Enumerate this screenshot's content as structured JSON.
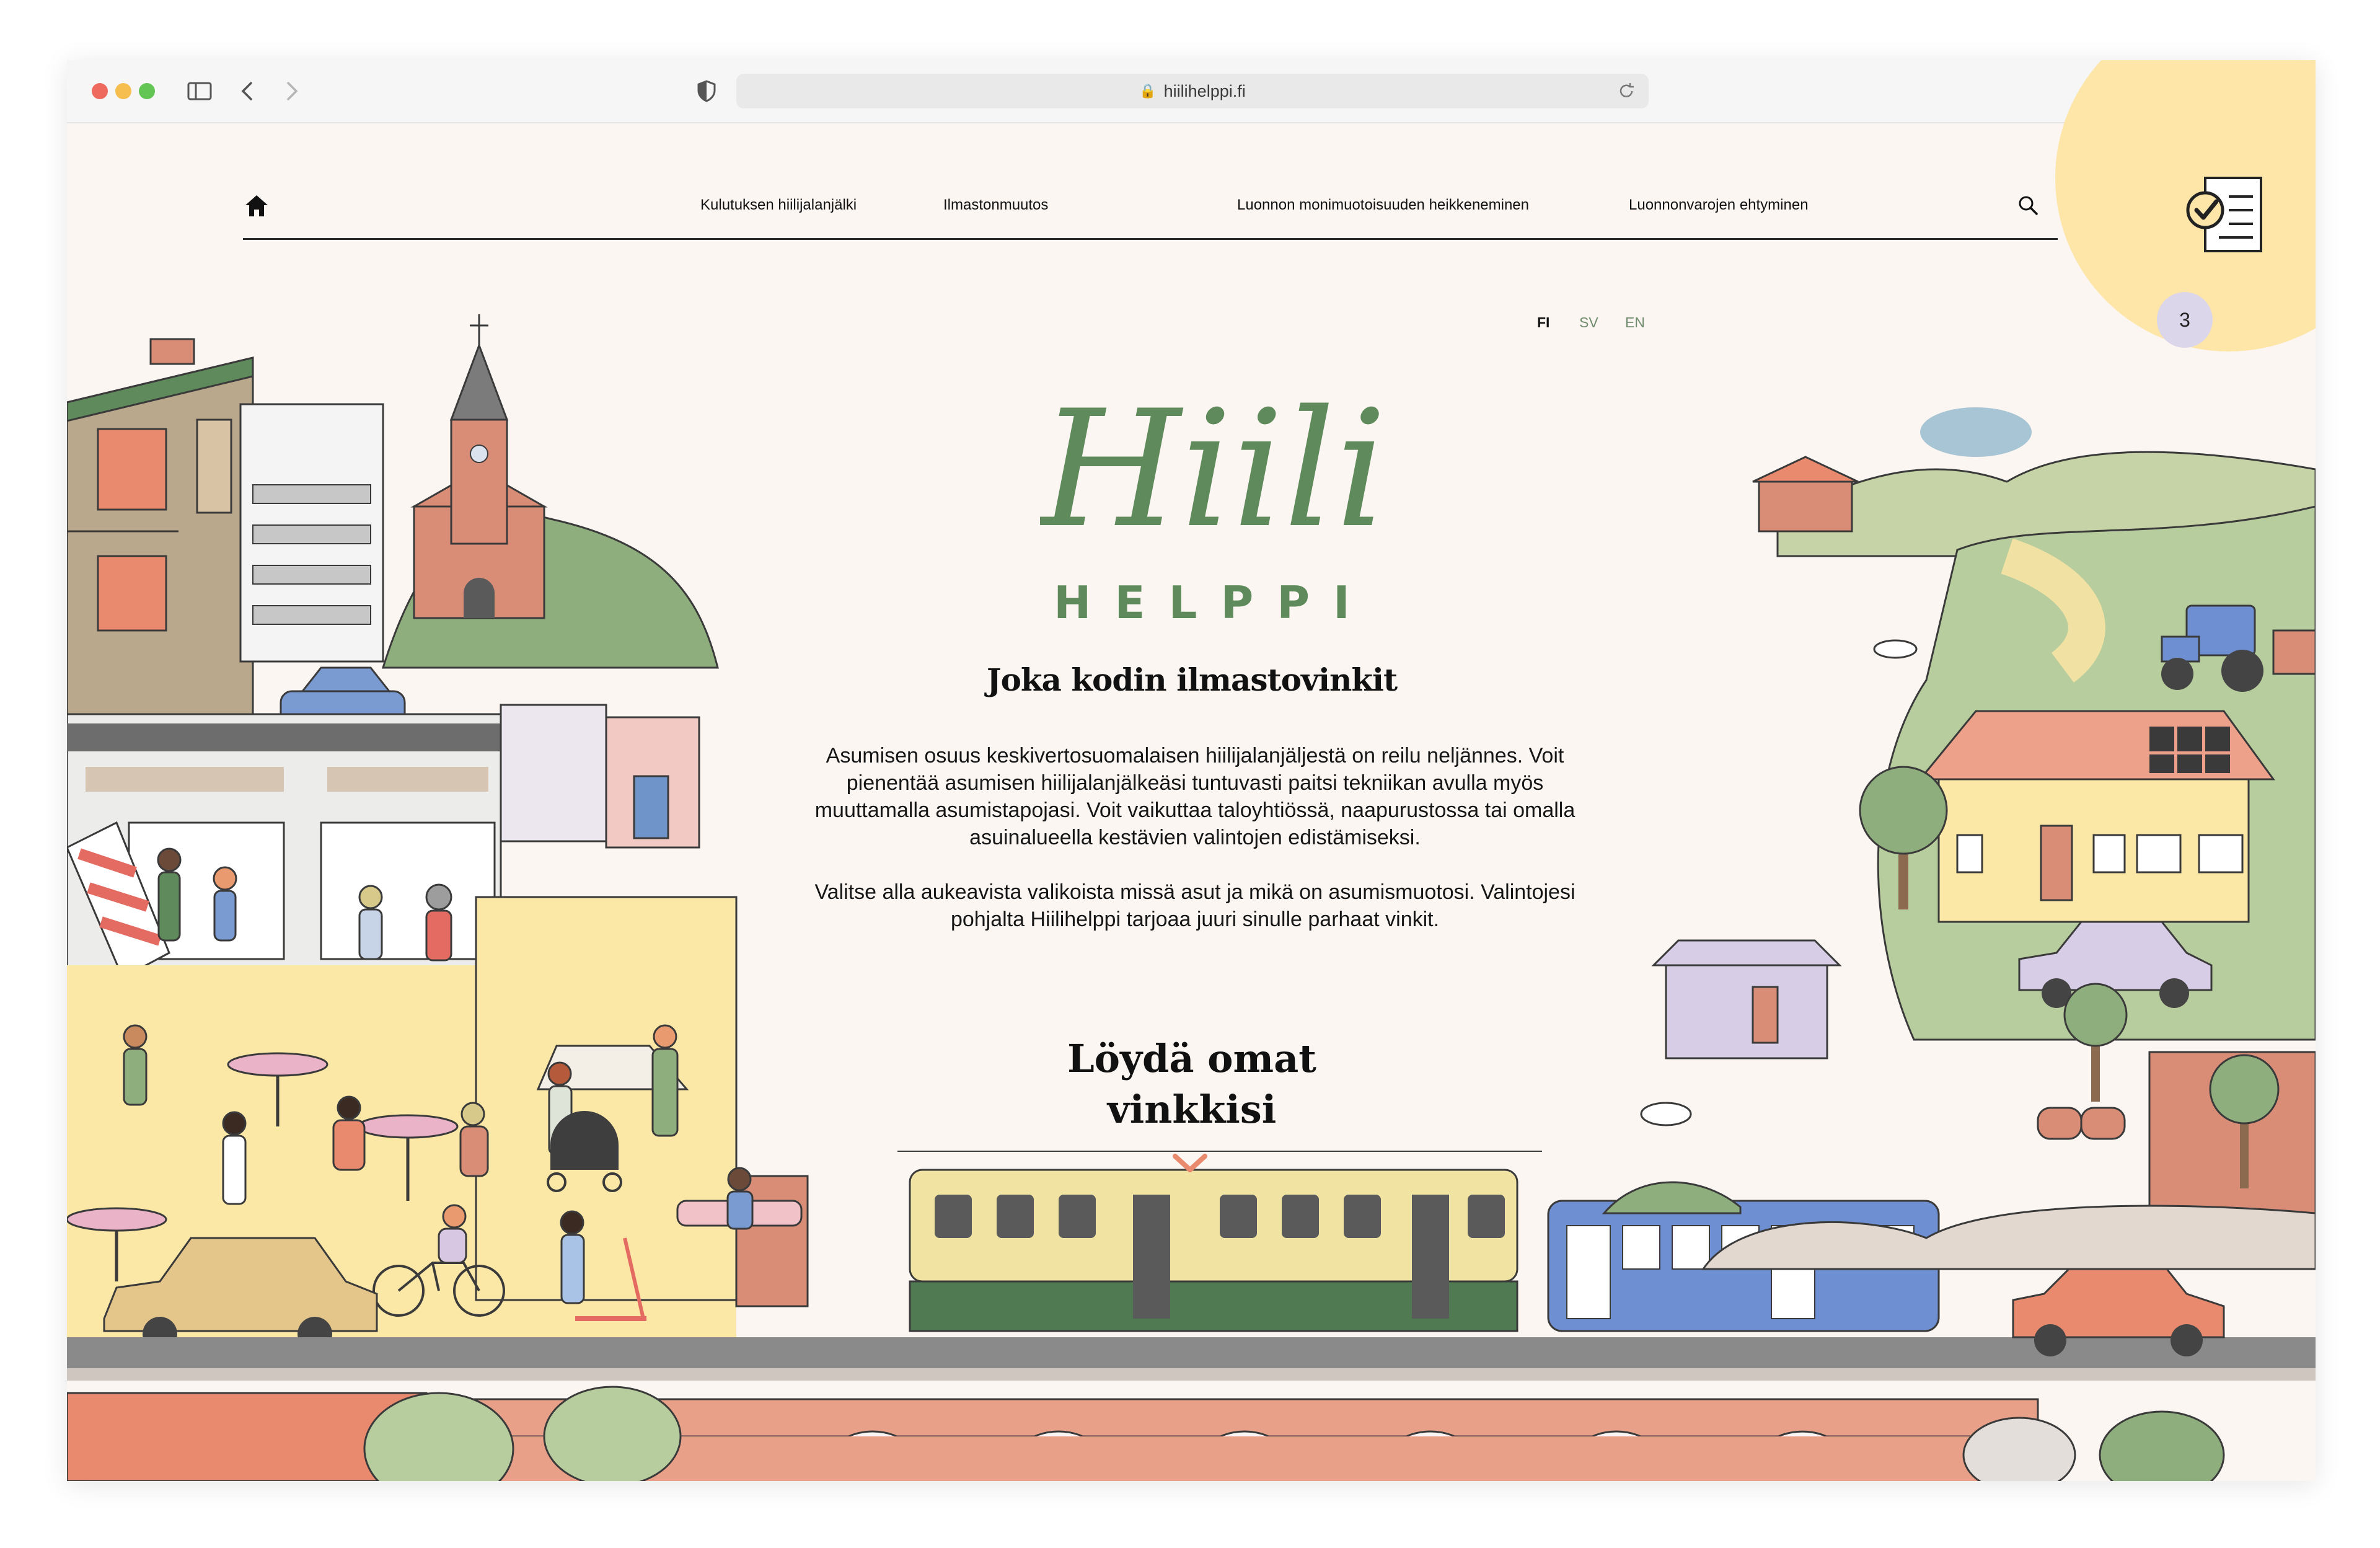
{
  "browser": {
    "url": "hiilihelppi.fi"
  },
  "nav": {
    "links": [
      "Kulutuksen hiilijalanjälki",
      "Ilmastonmuutos",
      "Luonnon monimuotoisuuden heikkeneminen",
      "Luonnonvarojen ehtyminen"
    ]
  },
  "languages": [
    "FI",
    "SV",
    "EN"
  ],
  "checklist": {
    "count": "3"
  },
  "logo": {
    "script": "Hiili",
    "sub": "HELPPI"
  },
  "hero": {
    "tagline": "Joka kodin ilmastovinkit",
    "paragraph1": "Asumisen osuus keskivertosuomalaisen hiilijalanjäljestä on reilu neljännes. Voit pienentää asumisen hiilijalanjälkeäsi tuntuvasti paitsi tekniikan avulla myös muuttamalla asumistapojasi. Voit vaikuttaa taloyhtiössä, naapurustossa tai omalla asuinalueella kestävien valintojen edistämiseksi.",
    "paragraph2": "Valitse alla aukeavista valikoista missä asut ja mikä on asumismuotosi. Valintojesi pohjalta Hiilihelppi tarjoaa juuri sinulle parhaat vinkit.",
    "cta_line1": "Löydä omat",
    "cta_line2": "vinkkisi"
  },
  "colors": {
    "brand_green": "#5f8a5b",
    "background": "#fbf6f2",
    "accent_yellow": "#fde6a8",
    "accent_salmon": "#e98a6e"
  }
}
